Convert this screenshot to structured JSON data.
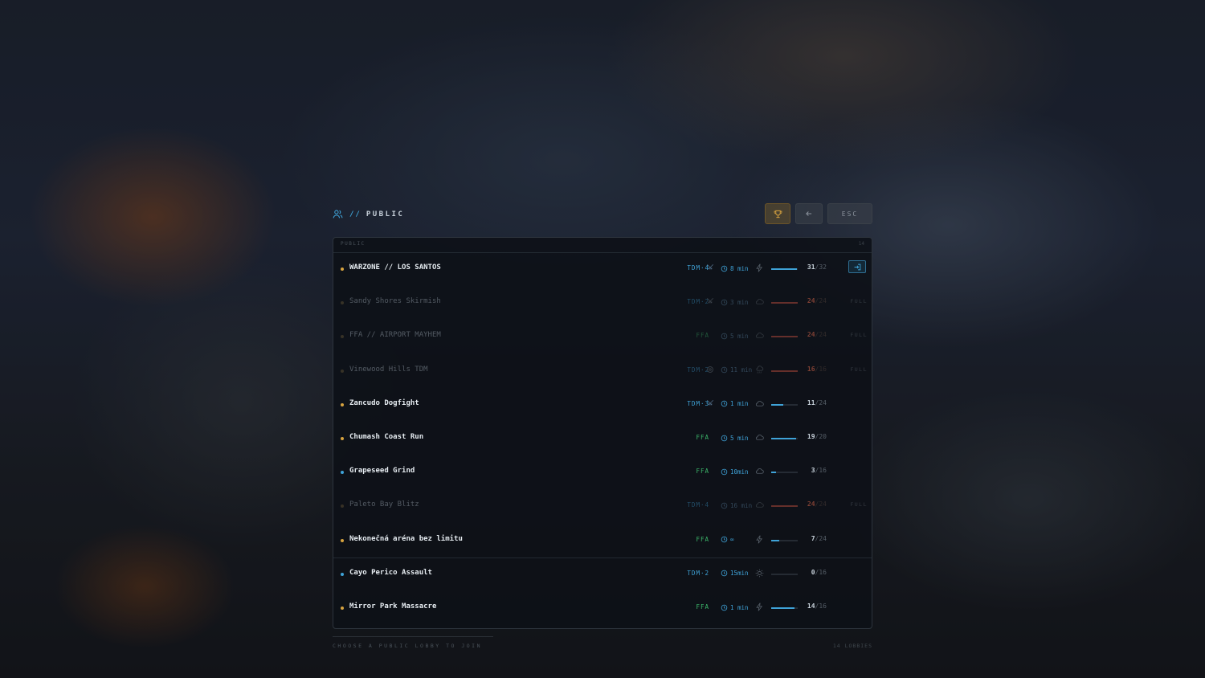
{
  "colors": {
    "accent": "#3fa3d8",
    "gold": "#d7a33f",
    "green": "#3cb86b",
    "red": "#c2432f",
    "text": "#e6ecf1",
    "muted": "#555e67"
  },
  "header": {
    "icon": "users-icon",
    "prefix": "//",
    "title": "PUBLIC",
    "buttons": {
      "trophy_icon": "trophy-icon",
      "back_icon": "arrow-left-icon",
      "esc_label": "ESC"
    }
  },
  "panel": {
    "label": "PUBLIC",
    "count": "14"
  },
  "lobbies": [
    {
      "name": "WARZONE // LOS SANTOS",
      "dot_color": "#d7a33f",
      "mode": "TDM·4",
      "mode_color": "#3fa3d8",
      "mode_icon": "crossed-swords-icon",
      "time": "8 min",
      "weather_icon": "lightning-icon",
      "players": "31",
      "max": "/32",
      "fill": 0.97,
      "bar_color": "#3fa3d8",
      "state": "joinable-selected",
      "dim": false
    },
    {
      "name": "Sandy Shores Skirmish",
      "dot_color": "#8a7040",
      "mode": "TDM·2",
      "mode_color": "#3fa3d8",
      "mode_icon": "crossed-swords-icon",
      "time": "3 min",
      "weather_icon": "cloud-icon",
      "players": "24",
      "max": "/24",
      "fill": 1.0,
      "bar_color": "#c2432f",
      "state": "full",
      "full_label": "FULL",
      "dim": true
    },
    {
      "name": "FFA // AIRPORT MAYHEM",
      "dot_color": "#8a7040",
      "mode": "FFA",
      "mode_color": "#3cb86b",
      "mode_icon": "",
      "time": "5 min",
      "weather_icon": "cloud-icon",
      "players": "24",
      "max": "/24",
      "fill": 1.0,
      "bar_color": "#c2432f",
      "state": "full",
      "full_label": "FULL",
      "dim": true
    },
    {
      "name": "Vinewood Hills TDM",
      "dot_color": "#8a7040",
      "mode": "TDM·2",
      "mode_color": "#3fa3d8",
      "mode_icon": "target-icon",
      "time": "11 min",
      "weather_icon": "rain-icon",
      "players": "16",
      "max": "/16",
      "fill": 1.0,
      "bar_color": "#c2432f",
      "state": "full",
      "full_label": "FULL",
      "dim": true
    },
    {
      "name": "Zancudo Dogfight",
      "dot_color": "#d7a33f",
      "mode": "TDM·3",
      "mode_color": "#3fa3d8",
      "mode_icon": "crossed-swords-icon",
      "time": "1 min",
      "weather_icon": "cloud-icon",
      "players": "11",
      "max": "/24",
      "fill": 0.46,
      "bar_color": "#3fa3d8",
      "state": "open",
      "dim": false
    },
    {
      "name": "Chumash Coast Run",
      "dot_color": "#d7a33f",
      "mode": "FFA",
      "mode_color": "#3cb86b",
      "mode_icon": "",
      "time": "5 min",
      "weather_icon": "cloud-icon",
      "players": "19",
      "max": "/20",
      "fill": 0.95,
      "bar_color": "#3fa3d8",
      "state": "open",
      "dim": false
    },
    {
      "name": "Grapeseed Grind",
      "dot_color": "#3fa3d8",
      "mode": "FFA",
      "mode_color": "#3cb86b",
      "mode_icon": "",
      "time": "10min",
      "weather_icon": "cloud-icon",
      "players": "3",
      "max": "/16",
      "fill": 0.19,
      "bar_color": "#3fa3d8",
      "state": "open",
      "dim": false
    },
    {
      "name": "Paleto Bay Blitz",
      "dot_color": "#8a7040",
      "mode": "TDM·4",
      "mode_color": "#3fa3d8",
      "mode_icon": "",
      "time": "16 min",
      "weather_icon": "cloud-icon",
      "players": "24",
      "max": "/24",
      "fill": 1.0,
      "bar_color": "#c2432f",
      "state": "full",
      "full_label": "FULL",
      "dim": true
    },
    {
      "name": "Nekonečná aréna bez limitu",
      "dot_color": "#d7a33f",
      "mode": "FFA",
      "mode_color": "#3cb86b",
      "mode_icon": "",
      "time": "∞",
      "weather_icon": "lightning-icon",
      "players": "7",
      "max": "/24",
      "fill": 0.29,
      "bar_color": "#3fa3d8",
      "state": "open",
      "dim": false
    },
    {
      "name": "Cayo Perico Assault",
      "dot_color": "#3fa3d8",
      "mode": "TDM·2",
      "mode_color": "#3fa3d8",
      "mode_icon": "",
      "time": "15min",
      "weather_icon": "sun-icon",
      "players": "0",
      "max": "/16",
      "fill": 0.0,
      "bar_color": "#3fa3d8",
      "state": "open",
      "dim": false
    },
    {
      "name": "Mirror Park Massacre",
      "dot_color": "#d7a33f",
      "mode": "FFA",
      "mode_color": "#3cb86b",
      "mode_icon": "",
      "time": "1 min",
      "weather_icon": "lightning-icon",
      "players": "14",
      "max": "/16",
      "fill": 0.88,
      "bar_color": "#3fa3d8",
      "state": "open",
      "dim": false
    }
  ],
  "footer": {
    "hint": "CHOOSE A PUBLIC LOBBY TO JOIN",
    "right": "14 LOBBIES"
  }
}
